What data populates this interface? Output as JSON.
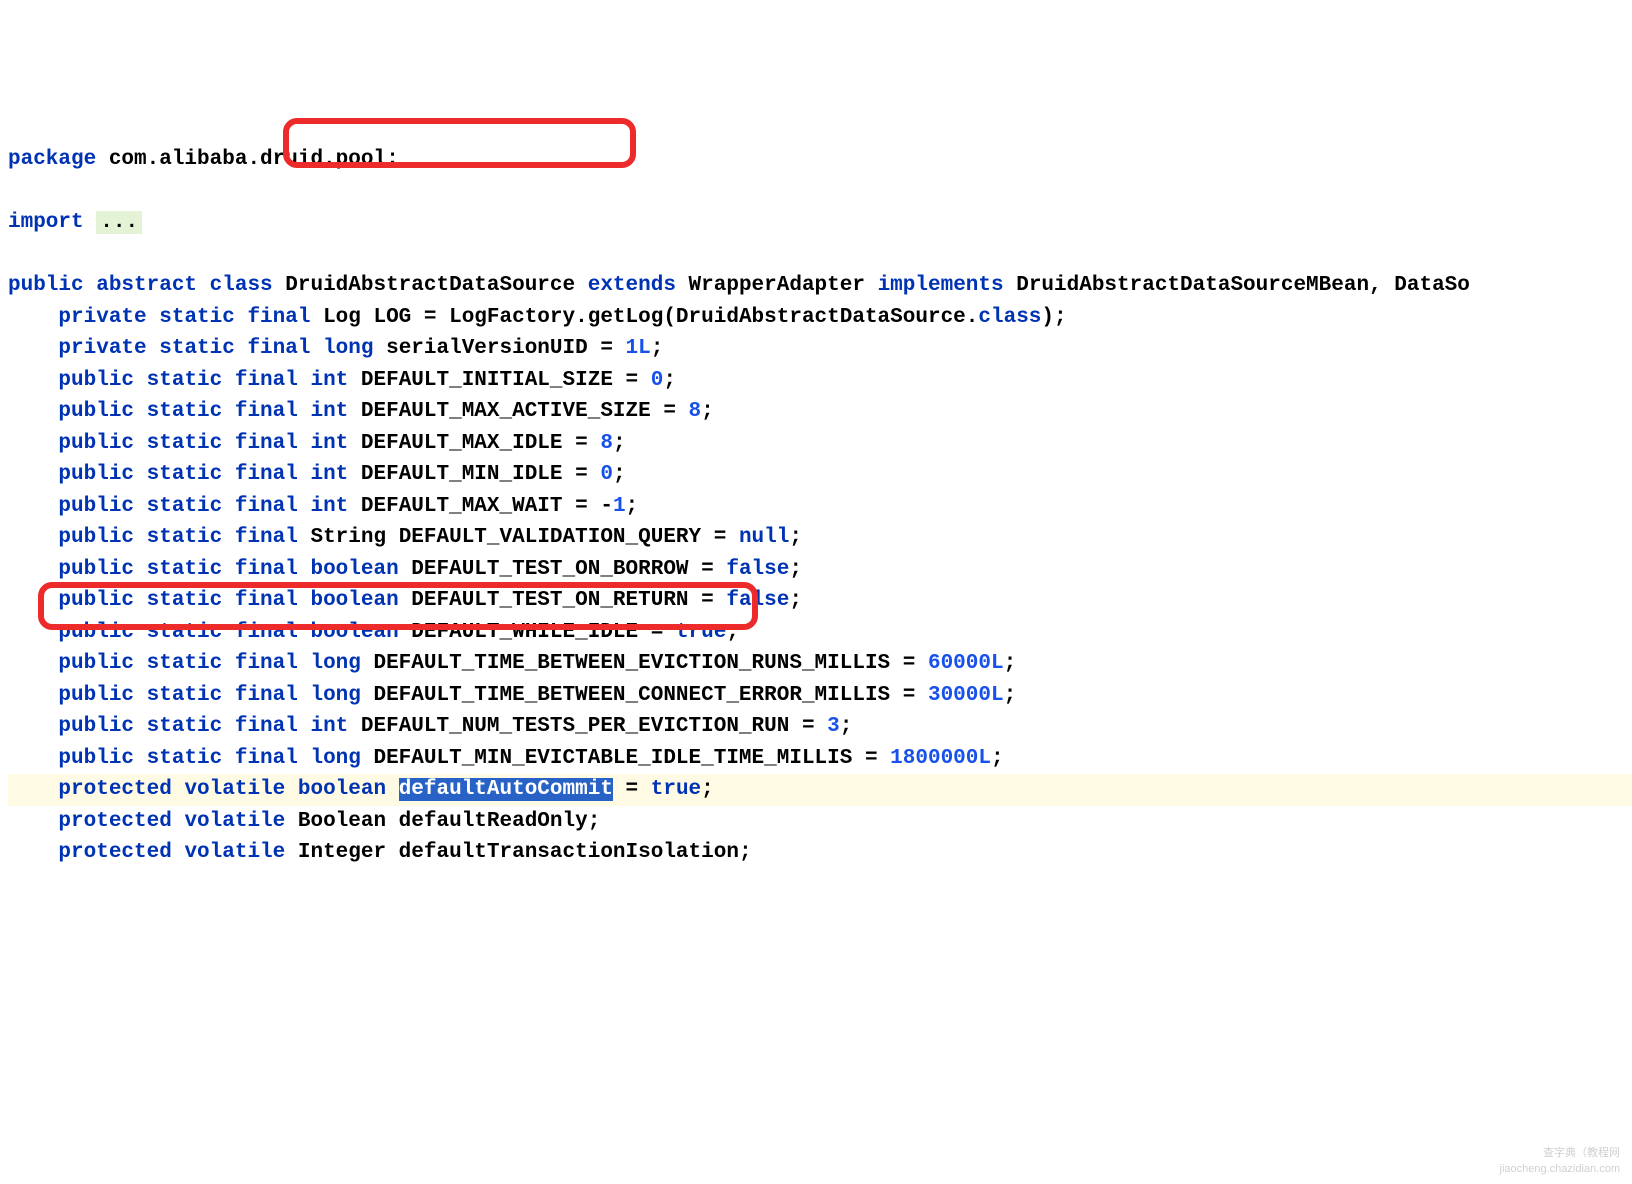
{
  "line1": {
    "kw1": "package",
    "txt1": " com.alibaba.druid.pool;"
  },
  "line3": {
    "kw1": "import",
    "ellipsis": "..."
  },
  "line5": {
    "kw1": "public abstract class",
    "txt1": " DruidAbstractDataSource ",
    "kw2": "extends",
    "txt2": " WrapperAdapter ",
    "kw3": "implements",
    "txt3": " DruidAbstractDataSourceMBean, DataSo"
  },
  "line6": {
    "indent": "    ",
    "kw1": "private static final",
    "txt1": " Log LOG = LogFactory.getLog(DruidAbstractDataSource.",
    "kw2": "class",
    "txt2": ");"
  },
  "line7": {
    "indent": "    ",
    "kw1": "private static final long",
    "txt1": " serialVersionUID = ",
    "num1": "1L",
    "txt2": ";"
  },
  "line8": {
    "indent": "    ",
    "kw1": "public static final int",
    "txt1": " DEFAULT_INITIAL_SIZE = ",
    "num1": "0",
    "txt2": ";"
  },
  "line9": {
    "indent": "    ",
    "kw1": "public static final int",
    "txt1": " DEFAULT_MAX_ACTIVE_SIZE = ",
    "num1": "8",
    "txt2": ";"
  },
  "line10": {
    "indent": "    ",
    "kw1": "public static final int",
    "txt1": " DEFAULT_MAX_IDLE = ",
    "num1": "8",
    "txt2": ";"
  },
  "line11": {
    "indent": "    ",
    "kw1": "public static final int",
    "txt1": " DEFAULT_MIN_IDLE = ",
    "num1": "0",
    "txt2": ";"
  },
  "line12": {
    "indent": "    ",
    "kw1": "public static final int",
    "txt1": " DEFAULT_MAX_WAIT = -",
    "num1": "1",
    "txt2": ";"
  },
  "line13": {
    "indent": "    ",
    "kw1": "public static final",
    "txt1": " String DEFAULT_VALIDATION_QUERY = ",
    "kw2": "null",
    "txt2": ";"
  },
  "line14": {
    "indent": "    ",
    "kw1": "public static final boolean",
    "txt1": " DEFAULT_TEST_ON_BORROW = ",
    "kw2": "false",
    "txt2": ";"
  },
  "line15": {
    "indent": "    ",
    "kw1": "public static final boolean",
    "txt1": " DEFAULT_TEST_ON_RETURN = ",
    "kw2": "false",
    "txt2": ";"
  },
  "line16": {
    "indent": "    ",
    "kw1": "public static final boolean",
    "txt1": " DEFAULT_WHILE_IDLE = ",
    "kw2": "true",
    "txt2": ";"
  },
  "line17": {
    "indent": "    ",
    "kw1": "public static final long",
    "txt1": " DEFAULT_TIME_BETWEEN_EVICTION_RUNS_MILLIS = ",
    "num1": "60000L",
    "txt2": ";"
  },
  "line18": {
    "indent": "    ",
    "kw1": "public static final long",
    "txt1": " DEFAULT_TIME_BETWEEN_CONNECT_ERROR_MILLIS = ",
    "num1": "30000L",
    "txt2": ";"
  },
  "line19": {
    "indent": "    ",
    "kw1": "public static final int",
    "txt1": " DEFAULT_NUM_TESTS_PER_EVICTION_RUN = ",
    "num1": "3",
    "txt2": ";"
  },
  "line20": {
    "indent": "    ",
    "kw1": "public static final long",
    "txt1": " DEFAULT_MIN_EVICTABLE_IDLE_TIME_MILLIS = ",
    "num1": "1800000L",
    "txt2": ";"
  },
  "line21": {
    "indent": "    ",
    "kw1": "protected volatile boolean",
    "txt1": " ",
    "sel": "defaultAutoCommit",
    "txt2": " = ",
    "kw2": "true",
    "txt3": ";"
  },
  "line22": {
    "indent": "    ",
    "kw1": "protected volatile",
    "txt1": " Boolean defaultReadOnly;"
  },
  "line23": {
    "indent": "    ",
    "kw1": "protected volatile",
    "txt1": " Integer defaultTransactionIsolation;"
  },
  "watermark": {
    "l1": "查字典（教程网",
    "l2": "jiaocheng.chazidian.com"
  }
}
